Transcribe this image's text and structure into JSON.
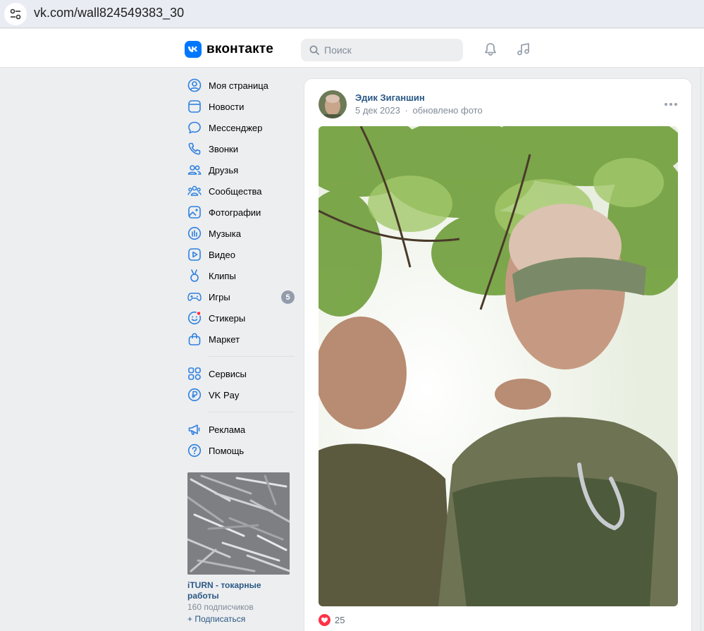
{
  "browser": {
    "url": "vk.com/wall824549383_30",
    "site_info_icon": "site-info-icon"
  },
  "header": {
    "logo_text": "вконтакте",
    "logo_mark": "К",
    "search_placeholder": "Поиск",
    "accent": "#0077ff"
  },
  "sidebar": {
    "items": [
      {
        "label": "Моя страница",
        "icon": "profile-icon"
      },
      {
        "label": "Новости",
        "icon": "news-icon"
      },
      {
        "label": "Мессенджер",
        "icon": "messenger-icon"
      },
      {
        "label": "Звонки",
        "icon": "phone-icon"
      },
      {
        "label": "Друзья",
        "icon": "friends-icon"
      },
      {
        "label": "Сообщества",
        "icon": "communities-icon"
      },
      {
        "label": "Фотографии",
        "icon": "photos-icon"
      },
      {
        "label": "Музыка",
        "icon": "music-icon"
      },
      {
        "label": "Видео",
        "icon": "video-icon"
      },
      {
        "label": "Клипы",
        "icon": "clips-icon"
      },
      {
        "label": "Игры",
        "icon": "games-icon",
        "badge": "5"
      },
      {
        "label": "Стикеры",
        "icon": "stickers-icon"
      },
      {
        "label": "Маркет",
        "icon": "market-icon"
      }
    ],
    "items2": [
      {
        "label": "Сервисы",
        "icon": "services-icon"
      },
      {
        "label": "VK Pay",
        "icon": "vkpay-icon"
      }
    ],
    "items3": [
      {
        "label": "Реклама",
        "icon": "ads-icon"
      },
      {
        "label": "Помощь",
        "icon": "help-icon"
      }
    ],
    "ad": {
      "title": "iTURN - токарные работы",
      "subscribers": "160 подписчиков",
      "subscribe": "+ Подписаться"
    }
  },
  "post": {
    "author": "Эдик Зиганшин",
    "date": "5 дек 2023",
    "separator": "·",
    "action": "обновлено фото",
    "likes": "25",
    "like_color": "#ff3347"
  }
}
